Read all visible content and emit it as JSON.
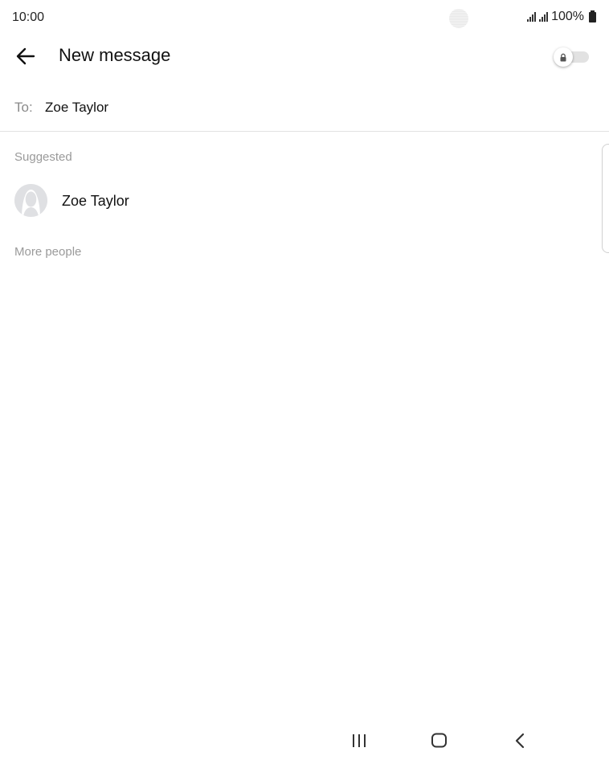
{
  "status_bar": {
    "time": "10:00",
    "battery": "100%"
  },
  "header": {
    "title": "New message",
    "back_icon": "arrow-left-icon",
    "secret_toggle_icon": "lock-icon",
    "secret_toggle_on": false
  },
  "compose": {
    "to_label": "To:",
    "to_value": "Zoe Taylor"
  },
  "suggested": {
    "label": "Suggested",
    "contacts": [
      {
        "name": "Zoe Taylor",
        "avatar": "default-avatar-icon"
      }
    ]
  },
  "more_people": {
    "label": "More people"
  },
  "nav_bar": {
    "recents_icon": "recents-icon",
    "home_icon": "home-icon",
    "back_icon": "back-icon"
  },
  "colors": {
    "background": "#ffffff",
    "muted_text": "#9a9a9a",
    "divider": "#e3e3e3"
  }
}
